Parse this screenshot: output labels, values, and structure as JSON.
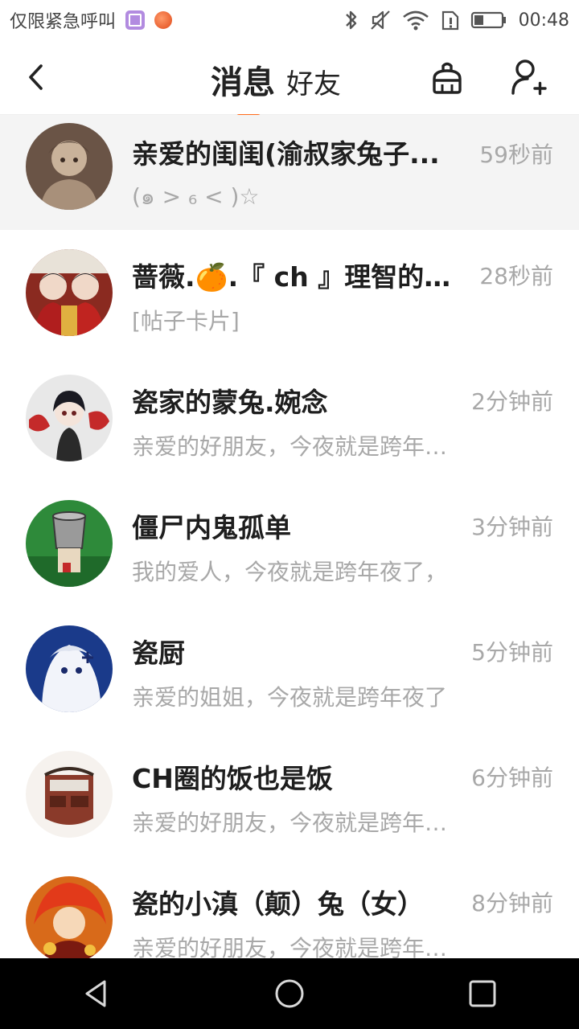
{
  "status_bar": {
    "carrier_text": "仅限紧急呼叫",
    "time": "00:48",
    "icons": [
      "gallery-app-icon",
      "notification-dot-icon",
      "bluetooth-icon",
      "mute-icon",
      "wifi-icon",
      "sim-icon",
      "battery-icon"
    ]
  },
  "header": {
    "tab_messages": "消息",
    "tab_friends": "好友",
    "active_tab": "消息",
    "accent_color": "#ff6a1a",
    "icons": [
      "back-icon",
      "broom-icon",
      "add-user-icon"
    ]
  },
  "conversations": [
    {
      "name": "亲爱的闺闺(渝叔家兔子...",
      "time": "59秒前",
      "preview": "(๑ > ₆ < )☆",
      "pinned": true,
      "avatar_color": "#6a5446"
    },
    {
      "name": "蔷薇.🍊.『 ch 』理智的低龄",
      "time": "28秒前",
      "preview": "[帖子卡片]",
      "pinned": false,
      "avatar_color": "#8a2a20"
    },
    {
      "name": "瓷家的蒙兔.婉念",
      "time": "2分钟前",
      "preview": "亲爱的好朋友，今夜就是跨年夜了",
      "pinned": false,
      "avatar_color": "#e8e8e8"
    },
    {
      "name": "僵尸内鬼孤单",
      "time": "3分钟前",
      "preview": "我的爱人，今夜就是跨年夜了，",
      "pinned": false,
      "avatar_color": "#2e8a3a"
    },
    {
      "name": "瓷厨",
      "time": "5分钟前",
      "preview": "亲爱的姐姐，今夜就是跨年夜了",
      "pinned": false,
      "avatar_color": "#1a3a8a"
    },
    {
      "name": "CH圈的饭也是饭",
      "time": "6分钟前",
      "preview": "亲爱的好朋友，今夜就是跨年夜了",
      "pinned": false,
      "avatar_color": "#8a3a2a"
    },
    {
      "name": "瓷的小滇（颠）兔（女）",
      "time": "8分钟前",
      "preview": "亲爱的好朋友，今夜就是跨年夜了",
      "pinned": false,
      "avatar_color": "#d86a1a"
    }
  ],
  "nav_bar": {
    "icons": [
      "nav-back-icon",
      "nav-home-icon",
      "nav-recents-icon"
    ]
  }
}
